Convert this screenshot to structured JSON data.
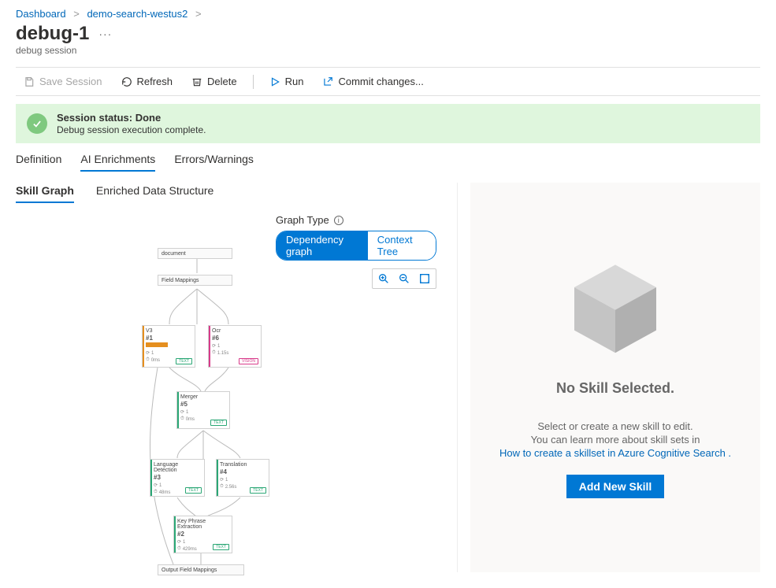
{
  "breadcrumb": {
    "items": [
      "Dashboard",
      "demo-search-westus2"
    ]
  },
  "page": {
    "title": "debug-1",
    "subtitle": "debug session"
  },
  "toolbar": {
    "save": "Save Session",
    "refresh": "Refresh",
    "delete": "Delete",
    "run": "Run",
    "commit": "Commit changes..."
  },
  "status": {
    "title": "Session status: Done",
    "detail": "Debug session execution complete."
  },
  "tabs": {
    "main": [
      "Definition",
      "AI Enrichments",
      "Errors/Warnings"
    ],
    "main_active": 1,
    "sub": [
      "Skill Graph",
      "Enriched Data Structure"
    ],
    "sub_active": 0
  },
  "graph": {
    "type_label": "Graph Type",
    "toggle": {
      "on": "Dependency graph",
      "off": "Context Tree"
    },
    "nodes": {
      "document": "document",
      "field_mappings": "Field Mappings",
      "n1": {
        "name": "V3",
        "hash": "#1",
        "runs": "1",
        "time": "0ms",
        "badge": "TEXT",
        "warn": true,
        "accent": "#e58f1f"
      },
      "n2": {
        "name": "Ocr",
        "hash": "#6",
        "runs": "1",
        "time": "1.15s",
        "badge": "VISION",
        "accent": "#d83b8a"
      },
      "n3": {
        "name": "Merger",
        "hash": "#5",
        "runs": "1",
        "time": "0ms",
        "badge": "TEXT",
        "accent": "#2aa775"
      },
      "n4": {
        "name": "Language Detection",
        "hash": "#3",
        "runs": "1",
        "time": "48ms",
        "badge": "TEXT",
        "accent": "#2aa775"
      },
      "n5": {
        "name": "Translation",
        "hash": "#4",
        "runs": "1",
        "time": "2.56s",
        "badge": "TEXT",
        "accent": "#2aa775"
      },
      "n6": {
        "name": "Key Phrase Extraction",
        "hash": "#2",
        "runs": "1",
        "time": "429ms",
        "badge": "TEXT",
        "accent": "#2aa775"
      },
      "output": "Output Field Mappings"
    }
  },
  "details": {
    "heading": "No Skill Selected.",
    "line1": "Select or create a new skill to edit.",
    "line2": "You can learn more about skill sets in",
    "link": "How to create a skillset in Azure Cognitive Search",
    "button": "Add New Skill"
  }
}
